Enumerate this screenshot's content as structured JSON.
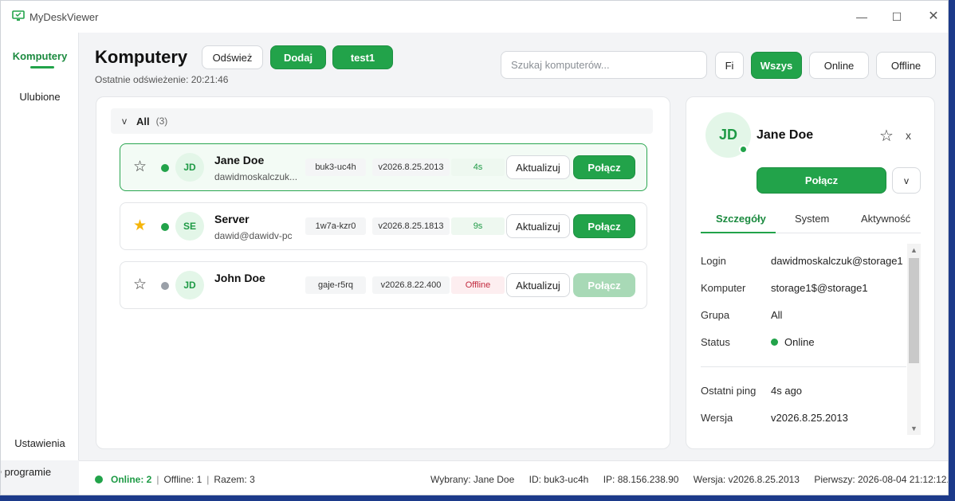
{
  "window": {
    "title": "MyDeskViewer",
    "minimize": "—",
    "maximize": "☐",
    "close": "✕"
  },
  "sidebar": {
    "items": [
      {
        "label": "Komputery",
        "active": true
      },
      {
        "label": "Ulubione"
      },
      {
        "label": "Ustawienia"
      },
      {
        "label": "O programie"
      }
    ]
  },
  "header": {
    "title": "Komputery",
    "last_refresh_label": "Ostatnie odświeżenie:",
    "last_refresh_time": "20:21:46",
    "refresh_button": "Odśwież",
    "add_button": "Dodaj",
    "test_button": "test1"
  },
  "search": {
    "placeholder": "Szukaj komputerów..."
  },
  "filters": {
    "fi": "Fi",
    "all": "Wszys",
    "online": "Online",
    "offline": "Offline",
    "active": "Wszys"
  },
  "group": {
    "chevron": "v",
    "name": "All",
    "count": "(3)"
  },
  "computers": [
    {
      "favorite": false,
      "status": "online",
      "initials": "JD",
      "name": "Jane Doe",
      "user": "dawidmoskalczuk...",
      "id": "buk3-uc4h",
      "version": "v2026.8.25.2013",
      "ping": "4s",
      "update_label": "Aktualizuj",
      "connect_label": "Połącz",
      "selected": true
    },
    {
      "favorite": true,
      "status": "online",
      "initials": "SE",
      "name": "Server",
      "user": "dawid@dawidv-pc",
      "id": "1w7a-kzr0",
      "version": "v2026.8.25.1813",
      "ping": "9s",
      "update_label": "Aktualizuj",
      "connect_label": "Połącz",
      "selected": false
    },
    {
      "favorite": false,
      "status": "offline",
      "initials": "JD",
      "name": "John Doe",
      "user": "",
      "id": "gaje-r5rq",
      "version": "v2026.8.22.400",
      "ping": "Offline",
      "update_label": "Aktualizuj",
      "connect_label": "Połącz",
      "selected": false
    }
  ],
  "detail": {
    "initials": "JD",
    "name": "Jane Doe",
    "star": "☆",
    "close": "x",
    "connect_label": "Połącz",
    "more_label": "v",
    "tabs": [
      "Szczegóły",
      "System",
      "Aktywność"
    ],
    "active_tab": "Szczegóły",
    "fields": [
      {
        "label": "Login",
        "value": "dawidmoskalczuk@storage1"
      },
      {
        "label": "Komputer",
        "value": "storage1$@storage1"
      },
      {
        "label": "Grupa",
        "value": "All"
      },
      {
        "label": "Status",
        "value": "Online"
      },
      {
        "label": "Ostatni ping",
        "value": "4s ago"
      },
      {
        "label": "Wersja",
        "value": "v2026.8.25.2013"
      }
    ]
  },
  "statusbar": {
    "online_label": "Online: 2",
    "offline_label": "Offline: 1",
    "total_label": "Razem: 3",
    "selected": "Wybrany: Jane Doe",
    "id": "ID: buk3-uc4h",
    "ip": "IP: 88.156.238.90",
    "version": "Wersja: v2026.8.25.2013",
    "first": "Pierwszy: 2026-08-04 21:12:12..."
  },
  "colors": {
    "accent": "#22a34a",
    "online": "#22a34a",
    "offline": "#9aa0a8",
    "favorite": "#f5b50a",
    "offline_text": "#c2293d"
  }
}
